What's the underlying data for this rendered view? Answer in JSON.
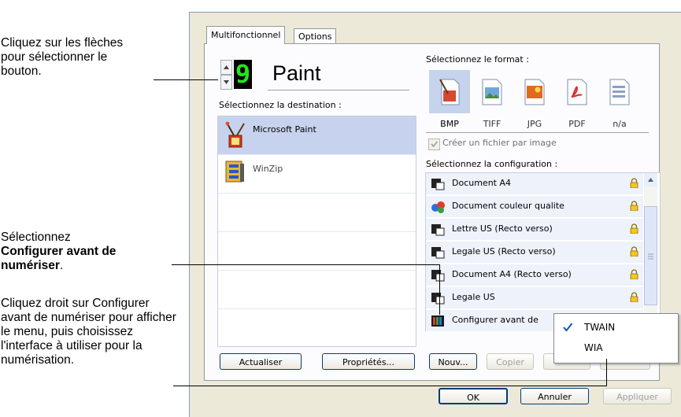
{
  "callouts": {
    "arrows_text": "Cliquez sur les flèches pour sélectionner le bouton.",
    "select_line1": "Sélectionnez",
    "select_bold": "Configurer avant de numériser",
    "select_end": ".",
    "rightclick_text": "Cliquez droit sur Configurer avant de numériser pour afficher le menu, puis choisissez l'interface à utiliser pour la numérisation."
  },
  "tabs": [
    {
      "label": "Multifonctionnel",
      "active": true
    },
    {
      "label": "Options",
      "active": false
    }
  ],
  "button_selector": {
    "digit": "9",
    "name": "Paint"
  },
  "destination": {
    "heading": "Sélectionnez la destination :",
    "items": [
      {
        "label": "Microsoft Paint",
        "icon": "paint-icon",
        "selected": true
      },
      {
        "label": "WinZip",
        "icon": "winzip-icon",
        "selected": false
      }
    ]
  },
  "format": {
    "heading": "Sélectionnez le format :",
    "items": [
      {
        "label": "BMP",
        "icon": "bmp-icon",
        "selected": true
      },
      {
        "label": "TIFF",
        "icon": "tiff-icon",
        "selected": false
      },
      {
        "label": "JPG",
        "icon": "jpg-icon",
        "selected": false
      },
      {
        "label": "PDF",
        "icon": "pdf-icon",
        "selected": false
      },
      {
        "label": "n/a",
        "icon": "na-icon",
        "selected": false
      }
    ],
    "checkbox_label": "Créer un fichier par image",
    "checkbox_checked": true
  },
  "configuration": {
    "heading": "Sélectionnez la configuration :",
    "items": [
      {
        "label": "Document A4",
        "icon": "bw-scan-icon"
      },
      {
        "label": "Document couleur qualite",
        "icon": "color-scan-icon"
      },
      {
        "label": "Lettre US (Recto verso)",
        "icon": "bw-scan-icon"
      },
      {
        "label": "Legale US (Recto verso)",
        "icon": "bw-scan-icon"
      },
      {
        "label": "Document A4 (Recto verso)",
        "icon": "bw-scan-icon"
      },
      {
        "label": "Legale US",
        "icon": "bw-scan-icon"
      },
      {
        "label": "Configurer avant de",
        "icon": "configure-icon"
      }
    ]
  },
  "buttons": {
    "refresh": "Actualiser",
    "properties": "Propriétés...",
    "new": "Nouv...",
    "copy": "Copier",
    "ok": "OK",
    "cancel": "Annuler",
    "apply": "Appliquer"
  },
  "context_menu": {
    "items": [
      {
        "label": "TWAIN",
        "checked": true
      },
      {
        "label": "WIA",
        "checked": false
      }
    ]
  }
}
